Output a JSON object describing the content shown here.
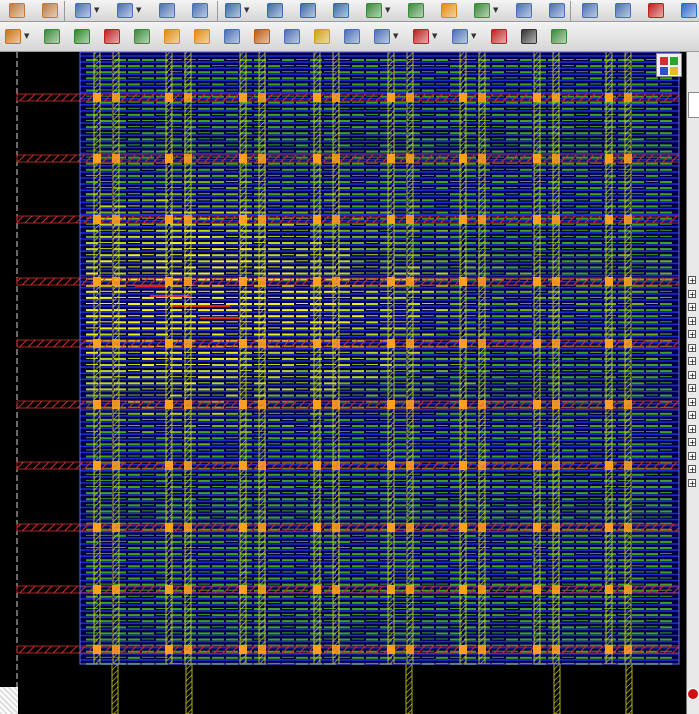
{
  "toolbar_row1": [
    {
      "name": "undo",
      "icon": "undo-arrow",
      "color": "#c07a3a",
      "dropdown": false
    },
    {
      "name": "redo",
      "icon": "redo-arrow",
      "color": "#c07a3a",
      "dropdown": false
    },
    {
      "name": "select-tool",
      "icon": "pencil-select",
      "color": "#4a6fb5",
      "dropdown": true
    },
    {
      "name": "route-tool",
      "icon": "pencil-route",
      "color": "#4a6fb5",
      "dropdown": true
    },
    {
      "name": "edit-wire",
      "icon": "pencil-wire",
      "color": "#4a6fb5",
      "dropdown": false
    },
    {
      "name": "check-tool",
      "icon": "pencil-check",
      "color": "#4a6fb5",
      "dropdown": false
    },
    {
      "name": "zoom-fit",
      "icon": "magnifier-fit",
      "color": "#3a6aa8",
      "dropdown": true
    },
    {
      "name": "zoom-in",
      "icon": "magnifier-plus",
      "color": "#3a6aa8",
      "dropdown": false
    },
    {
      "name": "zoom-out",
      "icon": "magnifier-minus",
      "color": "#3a6aa8",
      "dropdown": false
    },
    {
      "name": "zoom-select",
      "icon": "magnifier-box",
      "color": "#3a6aa8",
      "dropdown": false
    },
    {
      "name": "zoom-prev",
      "icon": "magnifier-back",
      "color": "#3a8a3a",
      "dropdown": true
    },
    {
      "name": "pan-tool",
      "icon": "green-arrow",
      "color": "#3a8a3a",
      "dropdown": false
    },
    {
      "name": "redraw",
      "icon": "orange-refresh",
      "color": "#e08a10",
      "dropdown": false
    },
    {
      "name": "highlight",
      "icon": "highlight-marker",
      "color": "#3a8a3a",
      "dropdown": true
    },
    {
      "name": "push-down",
      "icon": "hierarchy-down",
      "color": "#4a6fb5",
      "dropdown": false
    },
    {
      "name": "pop-up",
      "icon": "hierarchy-up",
      "color": "#4a6fb5",
      "dropdown": false
    },
    {
      "name": "window-layout",
      "icon": "window-grid",
      "color": "#4a6fb5",
      "dropdown": false
    },
    {
      "name": "net-tree",
      "icon": "tree-structure",
      "color": "#4a6fb5",
      "dropdown": false
    },
    {
      "name": "violations",
      "icon": "warning-triangle",
      "color": "#c02020",
      "dropdown": false
    },
    {
      "name": "info",
      "icon": "info-circle",
      "color": "#2a6ac8",
      "dropdown": false
    }
  ],
  "toolbar_row2": [
    {
      "name": "place-cell",
      "icon": "cell-orange",
      "color": "#d07010",
      "dropdown": true
    },
    {
      "name": "floorplan",
      "icon": "chip-floorplan",
      "color": "#3a8a3a",
      "dropdown": false
    },
    {
      "name": "percent-util",
      "icon": "percent-box",
      "color": "#2a8a2a",
      "dropdown": false
    },
    {
      "name": "cut-net",
      "icon": "scissors",
      "color": "#c02020",
      "dropdown": false
    },
    {
      "name": "add-blockage",
      "icon": "blocks-plus",
      "color": "#3a8a3a",
      "dropdown": false
    },
    {
      "name": "add-halo",
      "icon": "blocks-halo",
      "color": "#e08a10",
      "dropdown": false
    },
    {
      "name": "add-region",
      "icon": "region-star",
      "color": "#e08a10",
      "dropdown": false
    },
    {
      "name": "add-row",
      "icon": "row-plus",
      "color": "#4a6fb5",
      "dropdown": false
    },
    {
      "name": "add-guide",
      "icon": "guide-plus",
      "color": "#c05a10",
      "dropdown": false
    },
    {
      "name": "add-fence",
      "icon": "fence-plus",
      "color": "#4a6fb5",
      "dropdown": false
    },
    {
      "name": "wire-tool",
      "icon": "wire-segment",
      "color": "#d0a010",
      "dropdown": false
    },
    {
      "name": "select-pointer",
      "icon": "pointer-box",
      "color": "#4a6fb5",
      "dropdown": false
    },
    {
      "name": "add-stripe",
      "icon": "stripe-edit",
      "color": "#4a6fb5",
      "dropdown": true
    },
    {
      "name": "cut-wire",
      "icon": "scissors-wire",
      "color": "#c02020",
      "dropdown": true
    },
    {
      "name": "stretch",
      "icon": "stretch-arrows",
      "color": "#4a6fb5",
      "dropdown": true
    },
    {
      "name": "move-pointer",
      "icon": "pointer-move",
      "color": "#c02020",
      "dropdown": false
    },
    {
      "name": "measure",
      "icon": "pointer-ruler",
      "color": "#333333",
      "dropdown": false
    },
    {
      "name": "snap-grid",
      "icon": "grid-snap",
      "color": "#3a8a3a",
      "dropdown": false
    }
  ],
  "layout_colors": {
    "background": "#000000",
    "core_fill": "#000040",
    "blue_rail": "#2030e0",
    "red_stripe": "#d03030",
    "orange_via": "#ffa020",
    "yellow_stripe": "#d8d820",
    "green_signal": "#40a020",
    "yellow_signal": "#f0f020",
    "hot_red": "#e02020"
  },
  "panel_tree_rows": 16
}
